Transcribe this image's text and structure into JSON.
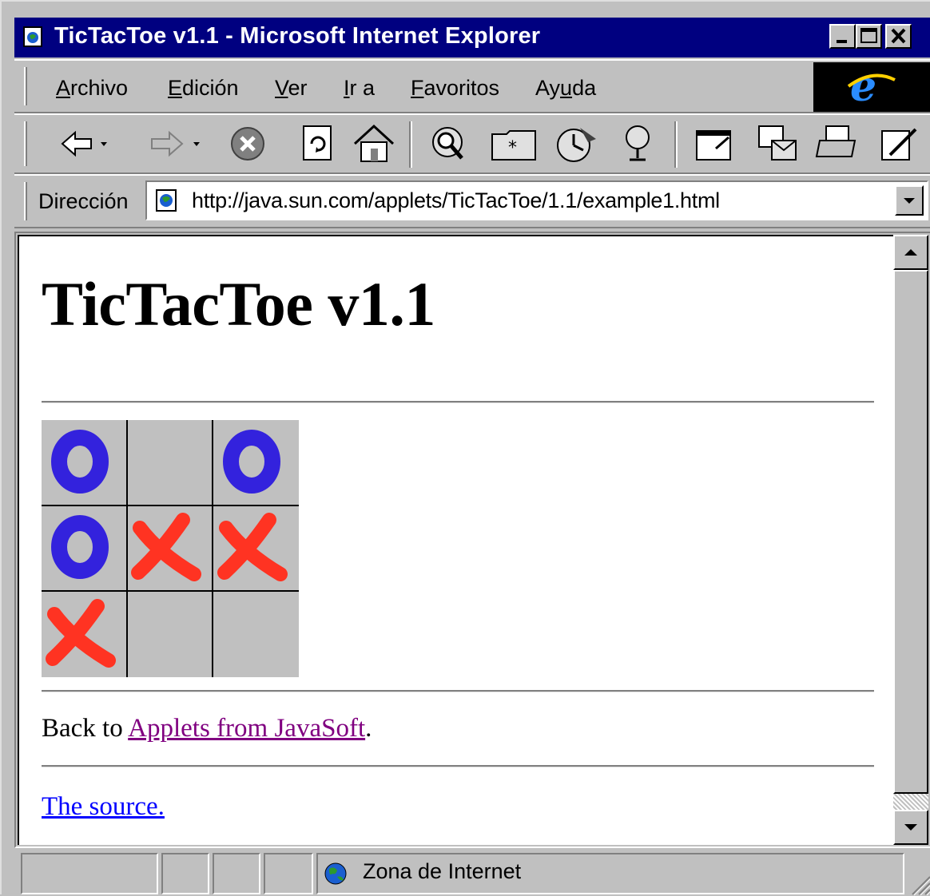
{
  "window": {
    "title": "TicTacToe v1.1 - Microsoft Internet Explorer",
    "controls": [
      "minimize-icon",
      "maximize-icon",
      "close-icon"
    ]
  },
  "menubar": {
    "items": [
      {
        "label": "Archivo",
        "accel": "A"
      },
      {
        "label": "Edición",
        "accel": "E"
      },
      {
        "label": "Ver",
        "accel": "V"
      },
      {
        "label": "Ir a",
        "accel": "I"
      },
      {
        "label": "Favoritos",
        "accel": "F"
      },
      {
        "label": "Ayuda",
        "accel": "u"
      }
    ]
  },
  "toolbar": {
    "buttons": [
      "back-arrow-icon",
      "back-dropdown-icon",
      "forward-arrow-icon",
      "forward-dropdown-icon",
      "stop-icon",
      "refresh-icon",
      "home-icon",
      "search-icon",
      "favorites-icon",
      "history-icon",
      "channels-icon",
      "fullscreen-icon",
      "mail-icon",
      "print-icon",
      "edit-icon"
    ]
  },
  "address": {
    "label": "Dirección",
    "url": "http://java.sun.com/applets/TicTacToe/1.1/example1.html"
  },
  "page": {
    "heading": "TicTacToe v1.1",
    "board": [
      "O",
      "",
      "O",
      "O",
      "X",
      "X",
      "X",
      "",
      ""
    ],
    "back_prefix": "Back to ",
    "back_link": "Applets from JavaSoft",
    "back_suffix": ".",
    "source_link": "The source."
  },
  "colors": {
    "titlebar": "#000080",
    "board_bg": "#c0c0c0",
    "o_mark": "#3322dd",
    "x_mark": "#ff3322",
    "visited_link": "#800080",
    "link": "#0000ff"
  },
  "statusbar": {
    "zone": "Zona de Internet"
  }
}
